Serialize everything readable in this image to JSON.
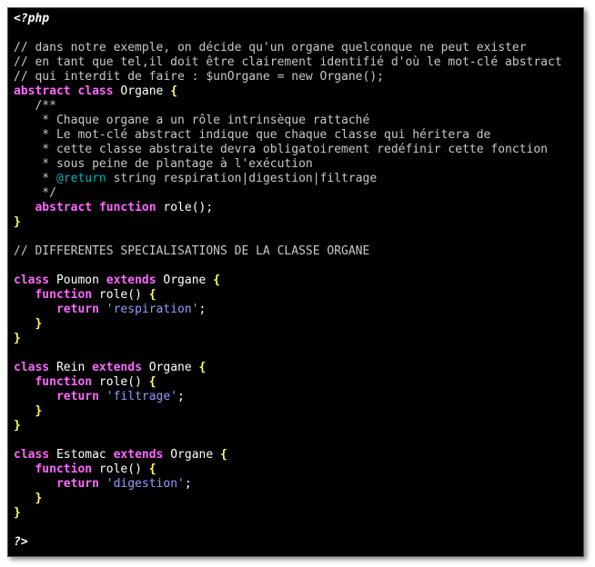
{
  "editor": {
    "lines": [
      [
        {
          "t": "<?php",
          "c": "tag"
        }
      ],
      [],
      [
        {
          "t": "// dans notre exemple, on décide qu'un organe quelconque ne peut exister",
          "c": "cm"
        }
      ],
      [
        {
          "t": "// en tant que tel,il doit être clairement identifié d'où le mot-clé abstract",
          "c": "cm"
        }
      ],
      [
        {
          "t": "// qui interdit de faire : $unOrgane = new Organe();",
          "c": "cm"
        }
      ],
      [
        {
          "t": "abstract",
          "c": "kw"
        },
        {
          "t": " "
        },
        {
          "t": "class",
          "c": "kw"
        },
        {
          "t": " Organe "
        },
        {
          "t": "{",
          "c": "br"
        }
      ],
      [
        {
          "t": "   /**",
          "c": "cm"
        }
      ],
      [
        {
          "t": "    * Chaque organe a un rôle intrinsèque rattaché",
          "c": "cm"
        }
      ],
      [
        {
          "t": "    * Le mot-clé abstract indique que chaque classe qui héritera de",
          "c": "cm"
        }
      ],
      [
        {
          "t": "    * cette classe abstraite devra obligatoirement redéfinir cette fonction",
          "c": "cm"
        }
      ],
      [
        {
          "t": "    * sous peine de plantage à l'exécution",
          "c": "cm"
        }
      ],
      [
        {
          "t": "    * ",
          "c": "cm"
        },
        {
          "t": "@return",
          "c": "doc"
        },
        {
          "t": " string respiration|digestion|filtrage",
          "c": "cm"
        }
      ],
      [
        {
          "t": "    */",
          "c": "cm"
        }
      ],
      [
        {
          "t": "   "
        },
        {
          "t": "abstract",
          "c": "kw"
        },
        {
          "t": " "
        },
        {
          "t": "function",
          "c": "kw"
        },
        {
          "t": " role();"
        }
      ],
      [
        {
          "t": "}",
          "c": "br"
        }
      ],
      [],
      [
        {
          "t": "// DIFFERENTES SPECIALISATIONS DE LA CLASSE ORGANE",
          "c": "cm"
        }
      ],
      [],
      [
        {
          "t": "class",
          "c": "kw"
        },
        {
          "t": " Poumon "
        },
        {
          "t": "extends",
          "c": "kw"
        },
        {
          "t": " Organe "
        },
        {
          "t": "{",
          "c": "br"
        }
      ],
      [
        {
          "t": "   "
        },
        {
          "t": "function",
          "c": "kw"
        },
        {
          "t": " role() "
        },
        {
          "t": "{",
          "c": "br"
        }
      ],
      [
        {
          "t": "      "
        },
        {
          "t": "return",
          "c": "kw"
        },
        {
          "t": " "
        },
        {
          "t": "'respiration'",
          "c": "str"
        },
        {
          "t": ";"
        }
      ],
      [
        {
          "t": "   "
        },
        {
          "t": "}",
          "c": "br"
        }
      ],
      [
        {
          "t": "}",
          "c": "br"
        }
      ],
      [],
      [
        {
          "t": "class",
          "c": "kw"
        },
        {
          "t": " Rein "
        },
        {
          "t": "extends",
          "c": "kw"
        },
        {
          "t": " Organe "
        },
        {
          "t": "{",
          "c": "br"
        }
      ],
      [
        {
          "t": "   "
        },
        {
          "t": "function",
          "c": "kw"
        },
        {
          "t": " role() "
        },
        {
          "t": "{",
          "c": "br"
        }
      ],
      [
        {
          "t": "      "
        },
        {
          "t": "return",
          "c": "kw"
        },
        {
          "t": " "
        },
        {
          "t": "'filtrage'",
          "c": "str"
        },
        {
          "t": ";"
        }
      ],
      [
        {
          "t": "   "
        },
        {
          "t": "}",
          "c": "br"
        }
      ],
      [
        {
          "t": "}",
          "c": "br"
        }
      ],
      [],
      [
        {
          "t": "class",
          "c": "kw"
        },
        {
          "t": " Estomac "
        },
        {
          "t": "extends",
          "c": "kw"
        },
        {
          "t": " Organe "
        },
        {
          "t": "{",
          "c": "br"
        }
      ],
      [
        {
          "t": "   "
        },
        {
          "t": "function",
          "c": "kw"
        },
        {
          "t": " role() "
        },
        {
          "t": "{",
          "c": "br"
        }
      ],
      [
        {
          "t": "      "
        },
        {
          "t": "return",
          "c": "kw"
        },
        {
          "t": " "
        },
        {
          "t": "'digestion'",
          "c": "str"
        },
        {
          "t": ";"
        }
      ],
      [
        {
          "t": "   "
        },
        {
          "t": "}",
          "c": "br"
        }
      ],
      [
        {
          "t": "}",
          "c": "br"
        }
      ],
      [],
      [
        {
          "t": "?>",
          "c": "tag"
        }
      ]
    ]
  },
  "colors": {
    "background": "#000000",
    "keyword": "#ff66ff",
    "brace": "#ffff66",
    "comment": "#c8c8c8",
    "string": "#9999ff",
    "doc_tag": "#00b3b3",
    "plain": "#ffffff"
  }
}
